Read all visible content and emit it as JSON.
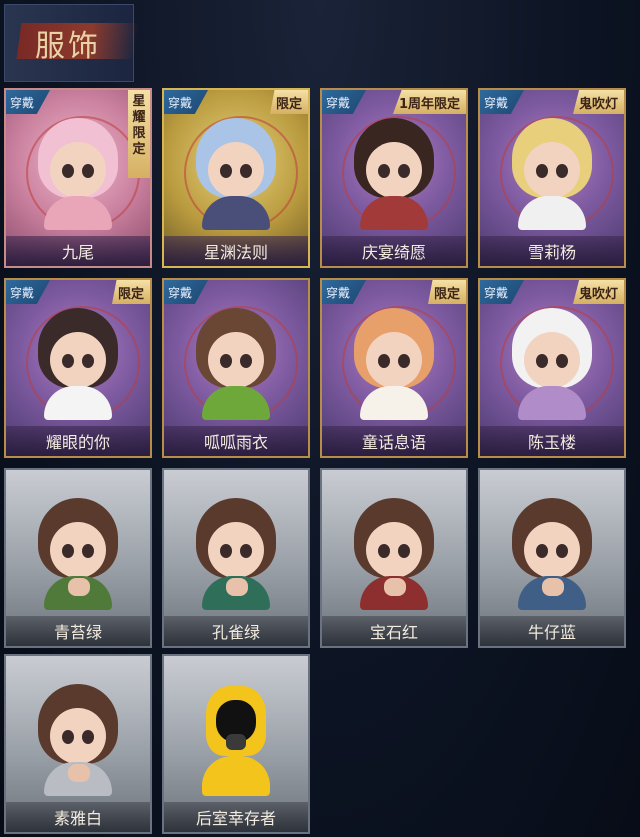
{
  "header": {
    "title": "服饰"
  },
  "badges": {
    "wear": "穿戴"
  },
  "colors": {
    "owned_frame": "#b88d4a",
    "locked_frame": "#6b7280",
    "wear_badge": "#2f6a9c",
    "tag_badge": "#d5b063"
  },
  "costumes": [
    {
      "name": "九尾",
      "wearing": true,
      "tag": "星耀限定",
      "tag_vertical": true
    },
    {
      "name": "星渊法则",
      "wearing": true,
      "tag": "限定"
    },
    {
      "name": "庆宴绮愿",
      "wearing": true,
      "tag": "1周年限定"
    },
    {
      "name": "雪莉杨",
      "wearing": true,
      "tag": "鬼吹灯"
    },
    {
      "name": "耀眼的你",
      "wearing": true,
      "tag": "限定"
    },
    {
      "name": "呱呱雨衣",
      "wearing": true,
      "tag": ""
    },
    {
      "name": "童话息语",
      "wearing": true,
      "tag": "限定"
    },
    {
      "name": "陈玉楼",
      "wearing": true,
      "tag": "鬼吹灯"
    },
    {
      "name": "青苔绿",
      "wearing": false,
      "tag": ""
    },
    {
      "name": "孔雀绿",
      "wearing": false,
      "tag": ""
    },
    {
      "name": "宝石红",
      "wearing": false,
      "tag": ""
    },
    {
      "name": "牛仔蓝",
      "wearing": false,
      "tag": ""
    },
    {
      "name": "素雅白",
      "wearing": false,
      "tag": ""
    },
    {
      "name": "后室幸存者",
      "wearing": false,
      "tag": ""
    }
  ]
}
